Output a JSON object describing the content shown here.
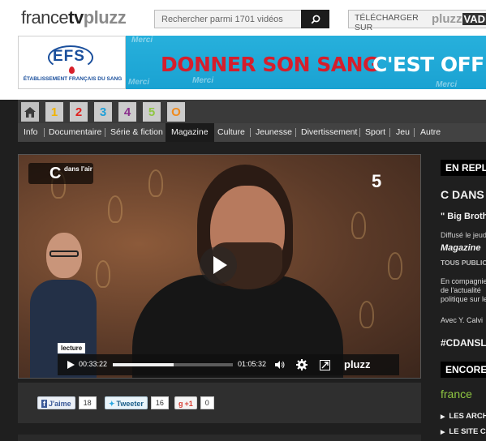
{
  "header": {
    "logo": {
      "france": "france",
      "tv": "tv",
      "pluzz": "pluzz"
    },
    "search": {
      "placeholder": "Rechercher parmi 1701 vidéos"
    },
    "download": {
      "label": "TÉLÉCHARGER SUR",
      "brand": "pluzz",
      "brand_suffix": "VAD"
    }
  },
  "banner": {
    "logo_text": "EFS",
    "logo_subtitle": "ÉTABLISSEMENT FRANÇAIS DU SANG",
    "slogan_1": "DONNER SON SANG",
    "slogan_2": "C'EST OFFRIR",
    "watermark": "Merci"
  },
  "channels": [
    "1",
    "2",
    "3",
    "4",
    "5",
    "O"
  ],
  "channel_colors": [
    "#f2b300",
    "#e0211f",
    "#1fa0d8",
    "#8a2e8c",
    "#8ec641",
    "#f08a1c"
  ],
  "categories": [
    "Info",
    "Documentaire",
    "Série & fiction",
    "Magazine",
    "Culture",
    "Jeunesse",
    "Divertissement",
    "Sport",
    "Jeu",
    "Autre"
  ],
  "active_category": "Magazine",
  "player": {
    "show_logo_c": "C",
    "show_logo_text": "dans l'air",
    "channel_bug": "5",
    "tooltip": "lecture",
    "current_time": "00:33:22",
    "duration": "01:05:32",
    "progress": 0.509,
    "brand": "pluzz"
  },
  "share": {
    "facebook_label": "J'aime",
    "facebook_count": "18",
    "twitter_label": "Tweeter",
    "twitter_count": "16",
    "google_label": "+1",
    "google_count": "0"
  },
  "sidebar": {
    "heading": "EN REPLAY",
    "show_title": "C DANS L'AIR",
    "episode_title": "\" Big Brother",
    "broadcast": "Diffusé le jeudi",
    "genre": "Magazine",
    "rating": "TOUS PUBLICS",
    "description": "En compagnie de l'actualité politique sur le",
    "presenter": "Avec Y. Calvi",
    "hashtag": "#CDANSLAIR",
    "more_heading": "ENCORE",
    "channel_name": "france",
    "links": [
      "LES ARCHIVES",
      "LE SITE C DANS L'AIR"
    ]
  }
}
